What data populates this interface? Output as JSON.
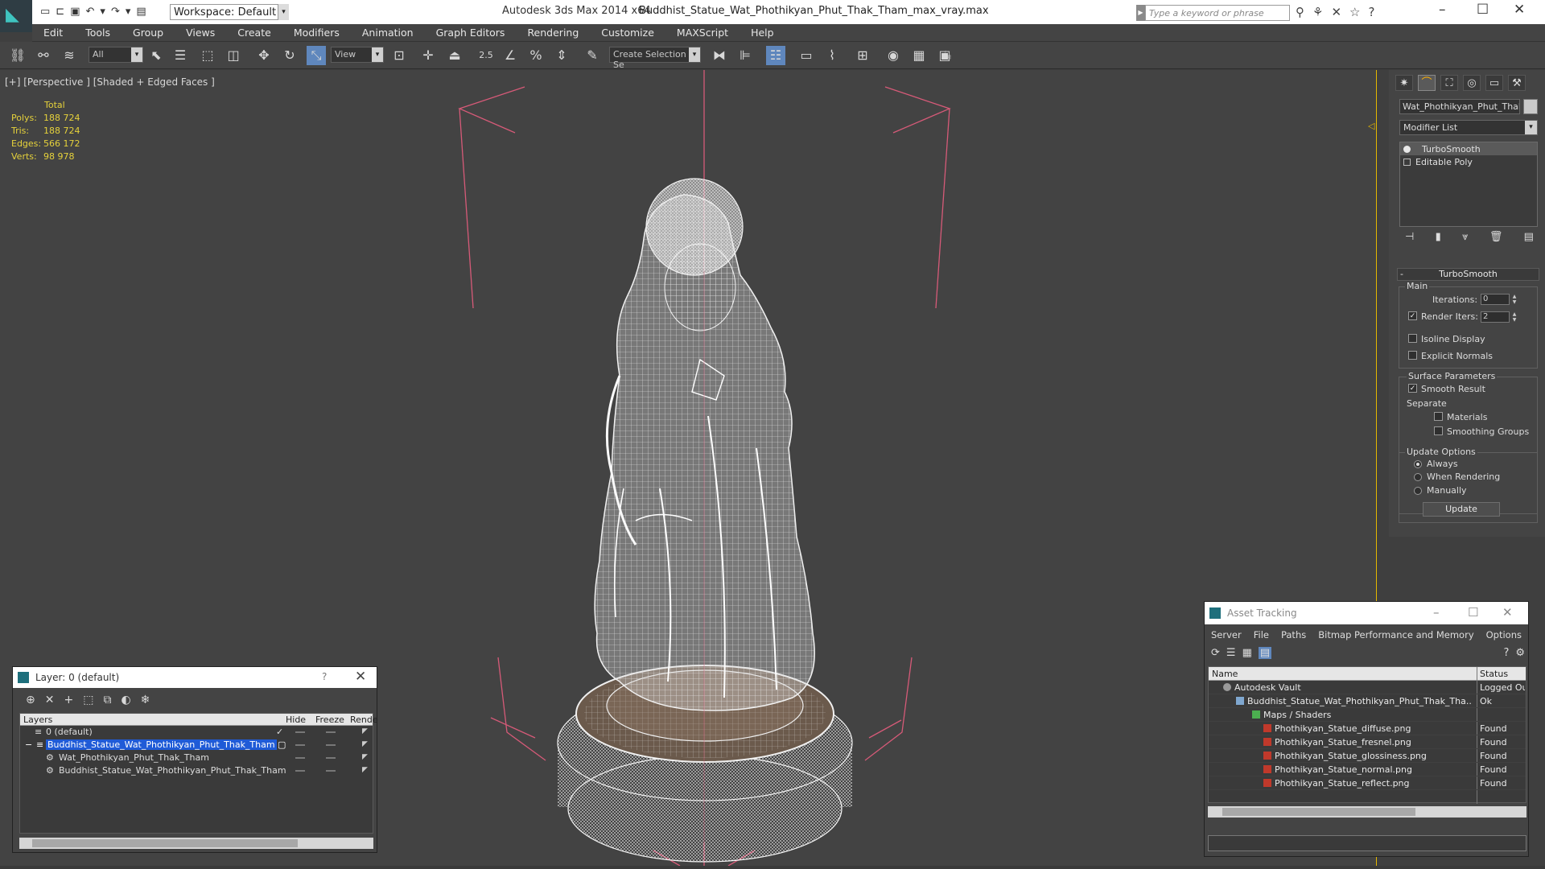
{
  "titlebar": {
    "workspace": "Workspace: Default",
    "app_title": "Autodesk 3ds Max  2014 x64",
    "file_title": "Buddhist_Statue_Wat_Phothikyan_Phut_Thak_Tham_max_vray.max",
    "search_placeholder": "Type a keyword or phrase"
  },
  "menu": [
    "Edit",
    "Tools",
    "Group",
    "Views",
    "Create",
    "Modifiers",
    "Animation",
    "Graph Editors",
    "Rendering",
    "Customize",
    "MAXScript",
    "Help"
  ],
  "toolbar": {
    "filter": "All",
    "ref_coord": "View",
    "snap_value": "2.5",
    "selection_set": "Create Selection Se"
  },
  "viewport": {
    "label": "[+] [Perspective ] [Shaded + Edged Faces ]",
    "stats": {
      "header": "Total",
      "rows": [
        {
          "k": "Polys:",
          "v": "188 724"
        },
        {
          "k": "Tris:",
          "v": "188 724"
        },
        {
          "k": "Edges:",
          "v": "566 172"
        },
        {
          "k": "Verts:",
          "v": "98 978"
        }
      ]
    }
  },
  "command_panel": {
    "object_name": "Wat_Phothikyan_Phut_Thak_",
    "modifier_list": "Modifier List",
    "stack": [
      "TurboSmooth",
      "Editable Poly"
    ],
    "rollout_title": "TurboSmooth",
    "main_label": "Main",
    "iterations_label": "Iterations:",
    "iterations_value": "0",
    "render_iters_label": "Render Iters:",
    "render_iters_value": "2",
    "isoline": "Isoline Display",
    "explicit_normals": "Explicit Normals",
    "surface_params": "Surface Parameters",
    "smooth_result": "Smooth Result",
    "separate": "Separate",
    "materials": "Materials",
    "smoothing_groups": "Smoothing Groups",
    "update_options": "Update Options",
    "always": "Always",
    "when_rendering": "When Rendering",
    "manually": "Manually",
    "update_btn": "Update"
  },
  "layer_window": {
    "title": "Layer: 0 (default)",
    "help": "?",
    "columns": {
      "layers": "Layers",
      "hide": "Hide",
      "freeze": "Freeze",
      "render": "Rende"
    },
    "rows": [
      {
        "name": "0 (default)"
      },
      {
        "name": "Buddhist_Statue_Wat_Phothikyan_Phut_Thak_Tham"
      },
      {
        "name": "Wat_Phothikyan_Phut_Thak_Tham"
      },
      {
        "name": "Buddhist_Statue_Wat_Phothikyan_Phut_Thak_Tham"
      }
    ]
  },
  "asset_window": {
    "title": "Asset Tracking",
    "menu": [
      "Server",
      "File",
      "Paths",
      "Bitmap Performance and Memory",
      "Options"
    ],
    "columns": {
      "name": "Name",
      "status": "Status"
    },
    "rows": [
      {
        "name": "Autodesk Vault",
        "status": "Logged Ou"
      },
      {
        "name": "Buddhist_Statue_Wat_Phothikyan_Phut_Thak_Tha...",
        "status": "Ok"
      },
      {
        "name": "Maps / Shaders",
        "status": ""
      },
      {
        "name": "Phothikyan_Statue_diffuse.png",
        "status": "Found"
      },
      {
        "name": "Phothikyan_Statue_fresnel.png",
        "status": "Found"
      },
      {
        "name": "Phothikyan_Statue_glossiness.png",
        "status": "Found"
      },
      {
        "name": "Phothikyan_Statue_normal.png",
        "status": "Found"
      },
      {
        "name": "Phothikyan_Statue_reflect.png",
        "status": "Found"
      }
    ]
  },
  "colors": {
    "accent_blue": "#5f87bd",
    "stats_yellow": "#e6d23b",
    "viewport_bg": "#434343",
    "bbox_pink": "#d65a78",
    "selection_blue": "#1f5bd7"
  }
}
